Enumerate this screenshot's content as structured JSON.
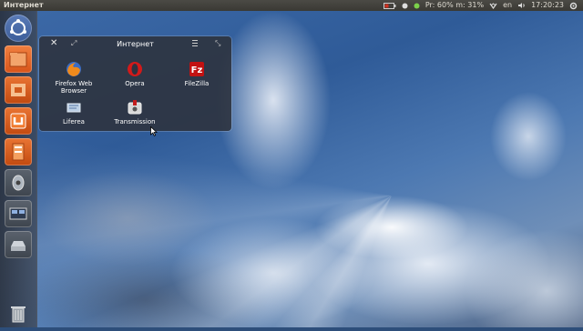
{
  "top_panel": {
    "window_title": "Интернет",
    "indicators": {
      "power_status": "Pr: 60% m: 31%",
      "keyboard_layout": "en",
      "clock": "17:20:23"
    }
  },
  "launcher": {
    "items": [
      "ubuntu-logo-icon",
      "home-folder-icon",
      "files-icon",
      "software-center-icon",
      "applications-icon",
      "sound-icon",
      "workspace-switcher-icon",
      "drive-icon",
      "trash-icon"
    ]
  },
  "folder": {
    "title": "Интернет",
    "close_glyph": "✕",
    "apps": [
      {
        "label_line1": "Firefox Web",
        "label_line2": "Browser"
      },
      {
        "label_line1": "Opera",
        "label_line2": ""
      },
      {
        "label_line1": "FileZilla",
        "label_line2": ""
      },
      {
        "label_line1": "Liferea",
        "label_line2": ""
      },
      {
        "label_line1": "Transmission",
        "label_line2": ""
      }
    ]
  },
  "colors": {
    "panel": "#3f3e39",
    "launcher_orange": "#e0661c",
    "sky": "#3d6aa8"
  }
}
